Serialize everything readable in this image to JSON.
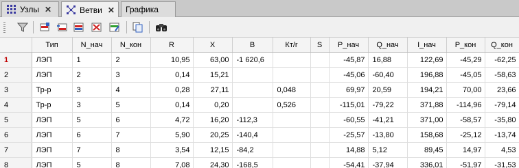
{
  "tabs": [
    {
      "label": "Узлы",
      "icon": "nodes-grid-icon",
      "active": false
    },
    {
      "label": "Ветви",
      "icon": "branches-grid-icon",
      "active": true
    },
    {
      "label": "Графика",
      "icon": "",
      "active": false
    }
  ],
  "toolbar": {
    "icons": [
      "filter-icon",
      "insert-row-icon",
      "add-row-icon",
      "duplicate-row-icon",
      "delete-row-icon",
      "edit-row-icon",
      "copy-icon",
      "find-icon"
    ]
  },
  "table": {
    "columns": [
      "Тип",
      "N_нач",
      "N_кон",
      "R",
      "X",
      "B",
      "Кт/r",
      "S",
      "P_нач",
      "Q_нач",
      "I_нач",
      "P_кон",
      "Q_кон"
    ],
    "rows": [
      {
        "num": "1",
        "cells": [
          "ЛЭП",
          "1",
          "2",
          "10,95",
          "63,00",
          "-1 620,6",
          "",
          "",
          "-45,87",
          "16,88",
          "122,69",
          "-45,29",
          "-62,25"
        ]
      },
      {
        "num": "2",
        "cells": [
          "ЛЭП",
          "2",
          "3",
          "0,14",
          "15,21",
          "",
          "",
          "",
          "-45,06",
          "-60,40",
          "196,88",
          "-45,05",
          "-58,63"
        ]
      },
      {
        "num": "3",
        "cells": [
          "Тр-р",
          "3",
          "4",
          "0,28",
          "27,11",
          "",
          "0,048",
          "",
          "69,97",
          "20,59",
          "194,21",
          "70,00",
          "23,66"
        ]
      },
      {
        "num": "4",
        "cells": [
          "Тр-р",
          "3",
          "5",
          "0,14",
          "0,20",
          "",
          "0,526",
          "",
          "-115,01",
          "-79,22",
          "371,88",
          "-114,96",
          "-79,14"
        ]
      },
      {
        "num": "5",
        "cells": [
          "ЛЭП",
          "5",
          "6",
          "4,72",
          "16,20",
          "-112,3",
          "",
          "",
          "-60,55",
          "-41,21",
          "371,00",
          "-58,57",
          "-35,80"
        ]
      },
      {
        "num": "6",
        "cells": [
          "ЛЭП",
          "6",
          "7",
          "5,90",
          "20,25",
          "-140,4",
          "",
          "",
          "-25,57",
          "-13,80",
          "158,68",
          "-25,12",
          "-13,74"
        ]
      },
      {
        "num": "7",
        "cells": [
          "ЛЭП",
          "7",
          "8",
          "3,54",
          "12,15",
          "-84,2",
          "",
          "",
          "14,88",
          "5,12",
          "89,45",
          "14,97",
          "4,53"
        ]
      },
      {
        "num": "8",
        "cells": [
          "ЛЭП",
          "5",
          "8",
          "7,08",
          "24,30",
          "-168,5",
          "",
          "",
          "-54,41",
          "-37,94",
          "336,01",
          "-51,97",
          "-31,53"
        ]
      }
    ]
  }
}
